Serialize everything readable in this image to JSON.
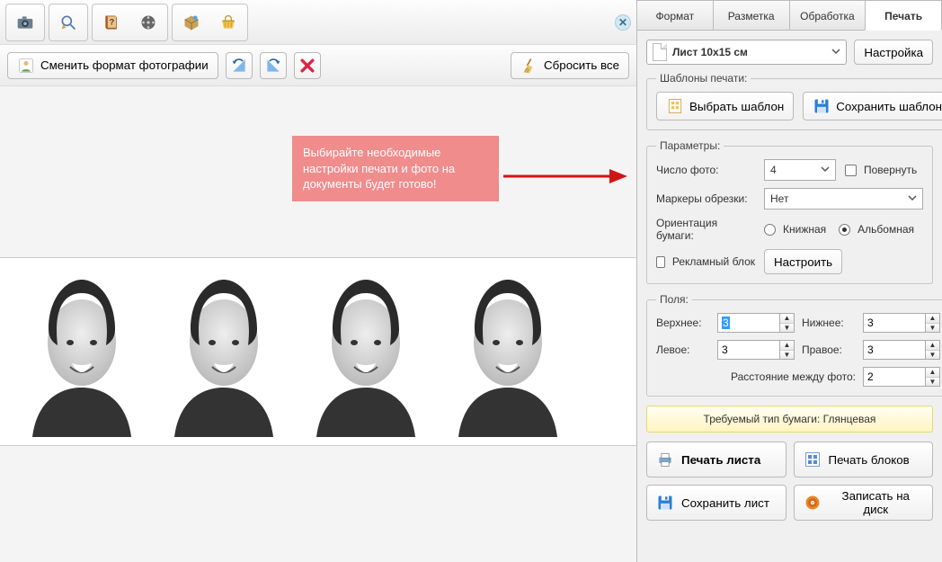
{
  "subbar": {
    "change_format": "Сменить формат фотографии",
    "reset_all": "Сбросить все"
  },
  "tip": {
    "text": "Выбирайте необходимые настройки печати и фото на документы будет готово!"
  },
  "tabs": {
    "format": "Формат",
    "layout": "Разметка",
    "processing": "Обработка",
    "print": "Печать"
  },
  "print": {
    "sheet_select": "Лист 10x15 см",
    "settings_btn": "Настройка",
    "templates_label": "Шаблоны печати:",
    "select_template_btn": "Выбрать шаблон",
    "save_template_btn": "Сохранить шаблон",
    "params_label": "Параметры:",
    "photo_count_label": "Число фото:",
    "photo_count_value": "4",
    "rotate_label": "Повернуть",
    "crop_markers_label": "Маркеры обрезки:",
    "crop_markers_value": "Нет",
    "orientation_label": "Ориентация бумаги:",
    "orient_portrait": "Книжная",
    "orient_landscape": "Альбомная",
    "ad_block_label": "Рекламный блок",
    "ad_config_btn": "Настроить",
    "margins_label": "Поля:",
    "margin_top_label": "Верхнее:",
    "margin_top_value": "3",
    "margin_bottom_label": "Нижнее:",
    "margin_bottom_value": "3",
    "margin_left_label": "Левое:",
    "margin_left_value": "3",
    "margin_right_label": "Правое:",
    "margin_right_value": "3",
    "photo_gap_label": "Расстояние между фото:",
    "photo_gap_value": "2",
    "paper_banner": "Требуемый тип бумаги: Глянцевая",
    "print_sheet_btn": "Печать листа",
    "print_blocks_btn": "Печать блоков",
    "save_sheet_btn": "Сохранить лист",
    "burn_disk_btn": "Записать на диск"
  }
}
